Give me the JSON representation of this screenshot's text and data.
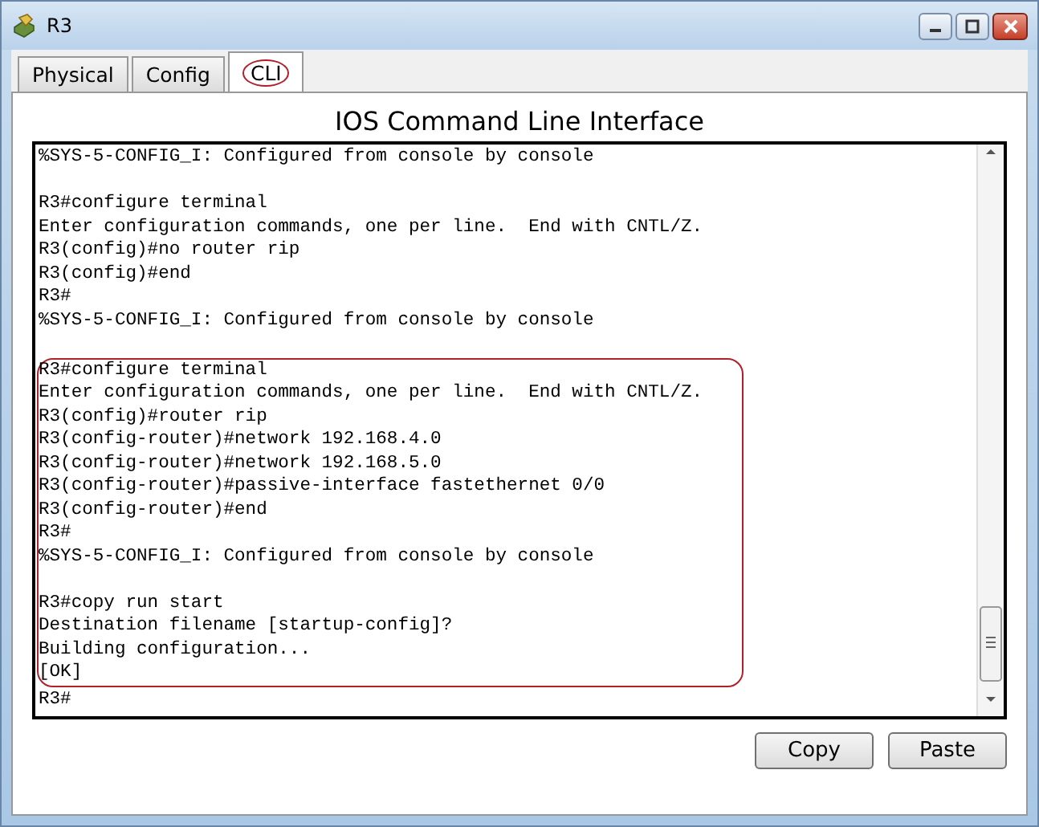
{
  "window": {
    "title": "R3"
  },
  "tabs": [
    {
      "label": "Physical",
      "selected": false,
      "circled": false
    },
    {
      "label": "Config",
      "selected": false,
      "circled": false
    },
    {
      "label": "CLI",
      "selected": true,
      "circled": true
    }
  ],
  "heading": "IOS Command Line Interface",
  "terminal": {
    "sections": [
      {
        "highlighted": false,
        "lines": [
          {
            "kind": "text",
            "text": "%SYS-5-CONFIG_I: Configured from console by console"
          },
          {
            "kind": "blank"
          },
          {
            "kind": "text",
            "text": "R3#configure terminal"
          },
          {
            "kind": "text",
            "text": "Enter configuration commands, one per line.  End with CNTL/Z."
          },
          {
            "kind": "text",
            "text": "R3(config)#no router rip"
          },
          {
            "kind": "text",
            "text": "R3(config)#end"
          },
          {
            "kind": "text",
            "text": "R3#"
          },
          {
            "kind": "text",
            "text": "%SYS-5-CONFIG_I: Configured from console by console"
          },
          {
            "kind": "blank"
          }
        ]
      },
      {
        "highlighted": true,
        "lines": [
          {
            "kind": "text",
            "text": "R3#configure terminal"
          },
          {
            "kind": "text",
            "text": "Enter configuration commands, one per line.  End with CNTL/Z."
          },
          {
            "kind": "text",
            "text": "R3(config)#router rip"
          },
          {
            "kind": "text",
            "text": "R3(config-router)#network 192.168.4.0"
          },
          {
            "kind": "text",
            "text": "R3(config-router)#network 192.168.5.0"
          },
          {
            "kind": "text",
            "text": "R3(config-router)#passive-interface fastethernet 0/0"
          },
          {
            "kind": "text",
            "text": "R3(config-router)#end"
          },
          {
            "kind": "text",
            "text": "R3#"
          },
          {
            "kind": "text",
            "text": "%SYS-5-CONFIG_I: Configured from console by console"
          },
          {
            "kind": "blank"
          },
          {
            "kind": "text",
            "text": "R3#copy run start"
          },
          {
            "kind": "text",
            "text": "Destination filename [startup-config]?"
          },
          {
            "kind": "text",
            "text": "Building configuration..."
          },
          {
            "kind": "text",
            "text": "[OK]"
          }
        ]
      },
      {
        "highlighted": false,
        "lines": [
          {
            "kind": "text",
            "text": "R3#"
          }
        ]
      }
    ]
  },
  "buttons": [
    "Copy",
    "Paste"
  ]
}
